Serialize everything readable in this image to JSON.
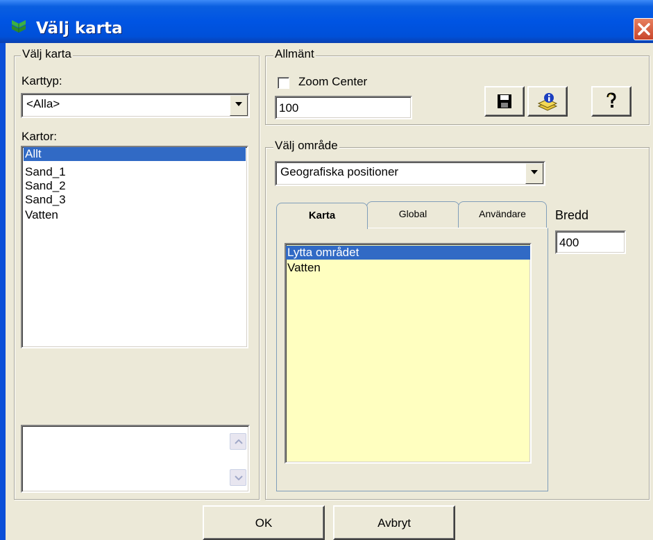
{
  "window": {
    "title": "Välj karta"
  },
  "left_panel": {
    "group_label": "Välj karta",
    "map_type_label": "Karttyp:",
    "map_type_value": "<Alla>",
    "maps_label": "Kartor:",
    "maps": [
      {
        "label": "Allt",
        "selected": true
      },
      {
        "label": "Sand_1",
        "selected": false
      },
      {
        "label": "Sand_2",
        "selected": false
      },
      {
        "label": "Sand_3",
        "selected": false
      },
      {
        "label": "Vatten",
        "selected": false
      }
    ]
  },
  "general": {
    "group_label": "Allmänt",
    "zoom_center_label": "Zoom Center",
    "zoom_center_checked": false,
    "zoom_value": "100"
  },
  "toolbar": {
    "save_icon": "floppy-disk-icon",
    "info_icon": "info-layers-icon",
    "help_icon": "question-mark-icon"
  },
  "area": {
    "group_label": "Välj område",
    "select_value": "Geografiska positioner",
    "tabs": [
      {
        "label": "Karta",
        "active": true
      },
      {
        "label": "Global",
        "active": false
      },
      {
        "label": "Användare",
        "active": false
      }
    ],
    "width_label": "Bredd",
    "width_value": "400",
    "items": [
      {
        "label": "Lytta området",
        "selected": true
      },
      {
        "label": "Vatten",
        "selected": false
      }
    ]
  },
  "buttons": {
    "ok": "OK",
    "cancel": "Avbryt"
  },
  "colors": {
    "titlebar": "#0054e3",
    "selection": "#316ac5",
    "list_bg_yellow": "#ffffc0",
    "dialog_bg": "#ece9d8"
  }
}
